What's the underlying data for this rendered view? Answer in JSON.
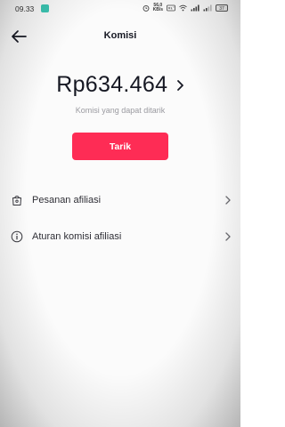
{
  "status_bar": {
    "time": "09.33",
    "network_speed_value": "56,0",
    "network_speed_unit": "KB/s",
    "battery": "37"
  },
  "header": {
    "title": "Komisi"
  },
  "balance": {
    "amount": "Rp634.464",
    "caption": "Komisi yang dapat ditarik"
  },
  "actions": {
    "withdraw_label": "Tarik"
  },
  "menu": {
    "items": [
      {
        "label": "Pesanan afiliasi",
        "icon": "shopping-bag-icon"
      },
      {
        "label": "Aturan komisi afiliasi",
        "icon": "info-icon"
      }
    ]
  },
  "colors": {
    "accent": "#fe2c55",
    "text_primary": "#161823",
    "text_secondary": "#9a9aa0"
  }
}
